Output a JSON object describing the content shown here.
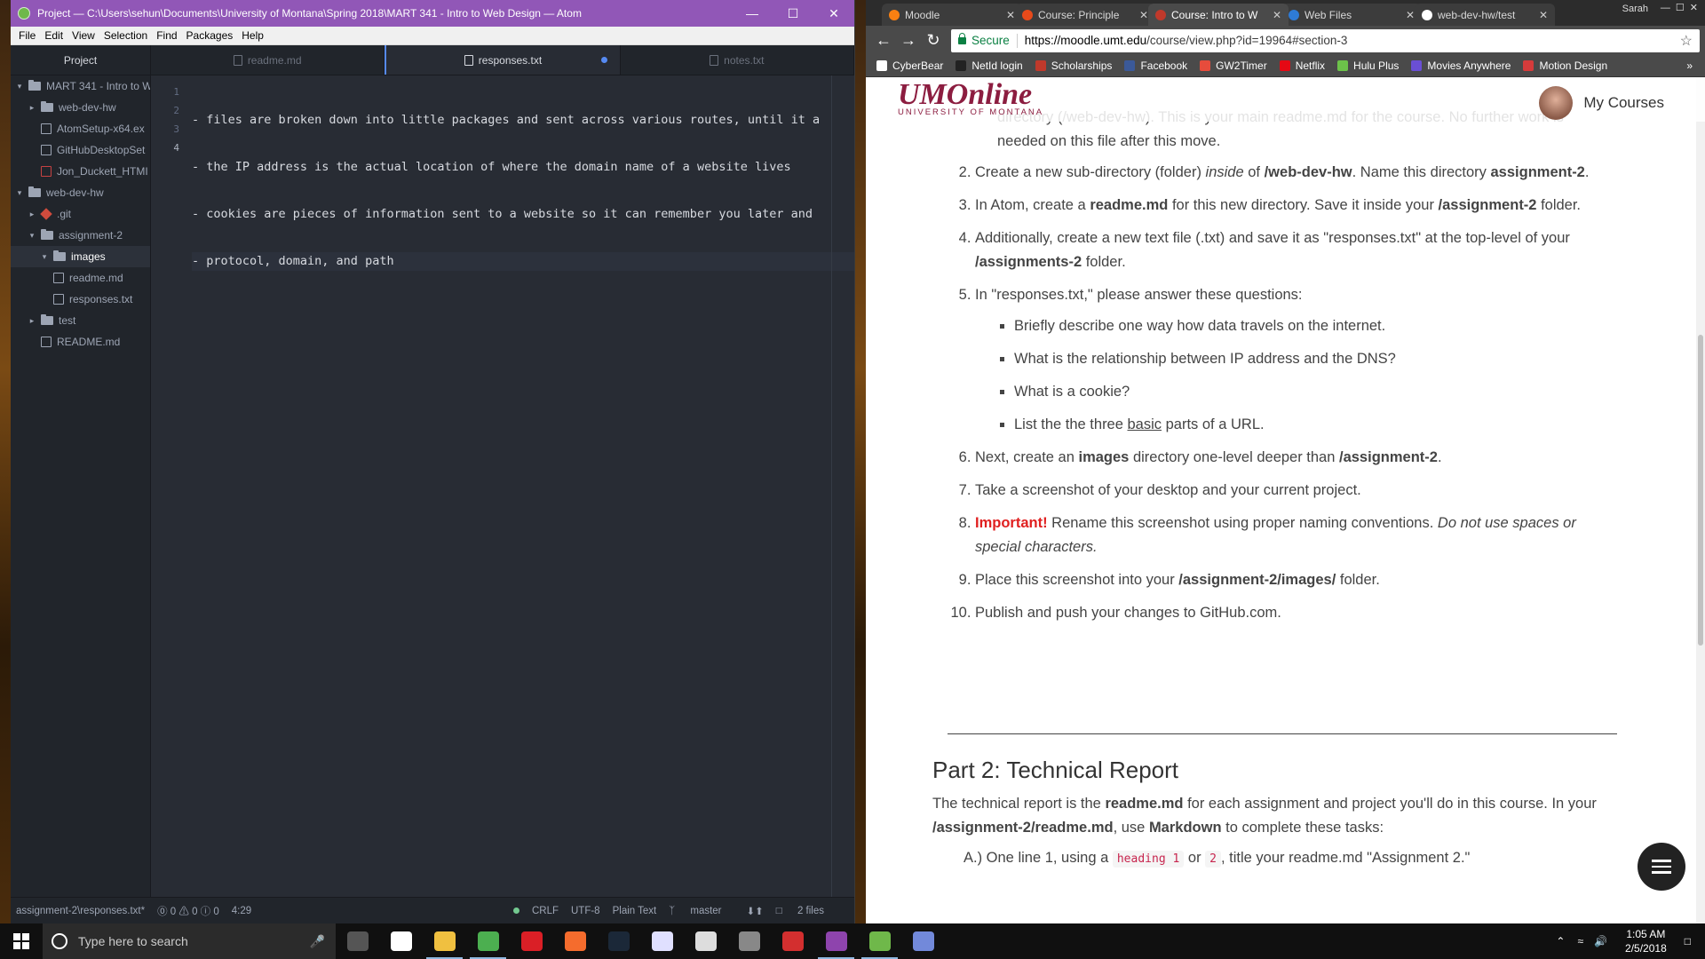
{
  "atom": {
    "title": "Project — C:\\Users\\sehun\\Documents\\University of Montana\\Spring 2018\\MART 341 - Intro to Web Design — Atom",
    "menu": [
      "File",
      "Edit",
      "View",
      "Selection",
      "Find",
      "Packages",
      "Help"
    ],
    "tree_header": "Project",
    "tree": [
      {
        "label": "MART 341 - Intro to W",
        "type": "folder",
        "arrow": "▾",
        "indent": 0
      },
      {
        "label": "web-dev-hw",
        "type": "folder",
        "arrow": "▸",
        "indent": 1
      },
      {
        "label": "AtomSetup-x64.ex",
        "type": "file",
        "arrow": "",
        "indent": 1
      },
      {
        "label": "GitHubDesktopSet",
        "type": "file",
        "arrow": "",
        "indent": 1
      },
      {
        "label": "Jon_Duckett_HTMI",
        "type": "pdf",
        "arrow": "",
        "indent": 1
      },
      {
        "label": "web-dev-hw",
        "type": "folder",
        "arrow": "▾",
        "indent": 0
      },
      {
        "label": ".git",
        "type": "git",
        "arrow": "▸",
        "indent": 1
      },
      {
        "label": "assignment-2",
        "type": "folder",
        "arrow": "▾",
        "indent": 1
      },
      {
        "label": "images",
        "type": "folder",
        "arrow": "▾",
        "indent": 2,
        "selected": true
      },
      {
        "label": "readme.md",
        "type": "file",
        "arrow": "",
        "indent": 2
      },
      {
        "label": "responses.txt",
        "type": "file",
        "arrow": "",
        "indent": 2
      },
      {
        "label": "test",
        "type": "folder",
        "arrow": "▸",
        "indent": 1
      },
      {
        "label": "README.md",
        "type": "file",
        "arrow": "",
        "indent": 1
      }
    ],
    "tabs": [
      {
        "label": "readme.md",
        "active": false
      },
      {
        "label": "responses.txt",
        "active": true,
        "modified": true
      },
      {
        "label": "notes.txt",
        "active": false
      }
    ],
    "lines": [
      "- files are broken down into little packages and sent across various routes, until it a",
      "- the IP address is the actual location of where the domain name of a website lives",
      "- cookies are pieces of information sent to a website so it can remember you later and",
      "- protocol, domain, and path"
    ],
    "line_numbers": [
      "1",
      "2",
      "3",
      "4"
    ],
    "status": {
      "file": "assignment-2\\responses.txt*",
      "diag": "⓪ 0 ⚠ 0 ⓘ 0",
      "cursor": "4:29",
      "eol": "CRLF",
      "encoding": "UTF-8",
      "grammar": "Plain Text",
      "branch": "master",
      "files": "2 files"
    }
  },
  "chrome": {
    "tabs": [
      {
        "label": "Moodle",
        "color": "#f98012"
      },
      {
        "label": "Course: Principle",
        "color": "#e84a1a"
      },
      {
        "label": "Course: Intro to W",
        "color": "#c0392b",
        "active": true
      },
      {
        "label": "Web Files",
        "color": "#2e7bd6"
      },
      {
        "label": "web-dev-hw/test",
        "color": "#ffffff"
      }
    ],
    "profile": "Sarah",
    "secure_label": "Secure",
    "url_host": "https://moodle.umt.edu",
    "url_path": "/course/view.php?id=19964#section-3",
    "bookmarks": [
      {
        "label": "CyberBear",
        "color": "#ffffff"
      },
      {
        "label": "NetId login",
        "color": "#222222"
      },
      {
        "label": "Scholarships",
        "color": "#c0392b"
      },
      {
        "label": "Facebook",
        "color": "#3b5998"
      },
      {
        "label": "GW2Timer",
        "color": "#e74c3c"
      },
      {
        "label": "Netflix",
        "color": "#e50914"
      },
      {
        "label": "Hulu Plus",
        "color": "#6cc24a"
      },
      {
        "label": "Movies Anywhere",
        "color": "#6a4fd4"
      },
      {
        "label": "Motion Design",
        "color": "#d63b3b"
      }
    ]
  },
  "moodle": {
    "logo": "UMOnline",
    "logo_sub": "UNIVERSITY OF MONTANA",
    "my_courses": "My Courses",
    "item1_tail": "directory (/web-dev-hw). This is your main readme.md for the course. No further work is needed on this file after this move.",
    "items": {
      "i2a": "Create a new sub-directory (folder) ",
      "i2b": "inside",
      "i2c": " of ",
      "i2d": "/web-dev-hw",
      "i2e": ". Name this directory ",
      "i2f": "assignment-2",
      "i2g": ".",
      "i3a": "In Atom, create a ",
      "i3b": "readme.md",
      "i3c": " for this new directory. Save it inside your ",
      "i3d": "/assignment-2",
      "i3e": " folder.",
      "i4a": "Additionally, create a new text file (.txt) and save it as \"responses.txt\" at the top-level of your ",
      "i4b": "/assignments-2",
      "i4c": " folder.",
      "i5": "In \"responses.txt,\" please answer these questions:",
      "q1": "Briefly describe one way how data travels on the internet.",
      "q2": "What is the relationship between IP address and the DNS?",
      "q3": "What is a cookie?",
      "q4a": "List the the three ",
      "q4b": "basic",
      "q4c": " parts of a URL.",
      "i6a": "Next, create an ",
      "i6b": "images",
      "i6c": " directory one-level deeper than ",
      "i6d": "/assignment-2",
      "i6e": ".",
      "i7": "Take a screenshot of your desktop and your current project.",
      "i8a": "Important!",
      "i8b": " Rename this screenshot using proper naming conventions. ",
      "i8c": "Do not use spaces or special characters.",
      "i9a": "Place this screenshot into your ",
      "i9b": "/assignment-2/images/",
      "i9c": " folder.",
      "i10": "Publish and push your changes to GitHub.com."
    },
    "part2_title": "Part 2: Technical Report",
    "part2_a": "The technical report is the ",
    "part2_b": "readme.md",
    "part2_c": " for each assignment and project you'll do in this course. In your ",
    "part2_d": "/assignment-2/readme.md",
    "part2_e": ", use ",
    "part2_f": "Markdown",
    "part2_g": " to complete these tasks:",
    "taskA_a": "A.) One line 1, using a ",
    "taskA_code1": "heading 1",
    "taskA_b": " or ",
    "taskA_code2": "2",
    "taskA_c": ", title your readme.md \"Assignment 2.\""
  },
  "taskbar": {
    "search_placeholder": "Type here to search",
    "apps": [
      {
        "name": "task-view",
        "color": "#555555",
        "running": false
      },
      {
        "name": "mail",
        "color": "#ffffff",
        "running": false
      },
      {
        "name": "file-explorer",
        "color": "#f0c040",
        "running": true
      },
      {
        "name": "chrome",
        "color": "#4caf50",
        "running": true
      },
      {
        "name": "creative-cloud",
        "color": "#da1f26",
        "running": false
      },
      {
        "name": "origin",
        "color": "#f56c2d",
        "running": false
      },
      {
        "name": "steam",
        "color": "#1b2838",
        "running": false
      },
      {
        "name": "itunes",
        "color": "#e0e0ff",
        "running": false
      },
      {
        "name": "app-s",
        "color": "#dddddd",
        "running": false
      },
      {
        "name": "app-wolf",
        "color": "#888888",
        "running": false
      },
      {
        "name": "app-red",
        "color": "#d32f2f",
        "running": false
      },
      {
        "name": "app-purple",
        "color": "#8e44ad",
        "running": true
      },
      {
        "name": "atom",
        "color": "#6fb84a",
        "running": true
      },
      {
        "name": "discord",
        "color": "#7289da",
        "running": false
      }
    ],
    "time": "1:05 AM",
    "date": "2/5/2018"
  }
}
